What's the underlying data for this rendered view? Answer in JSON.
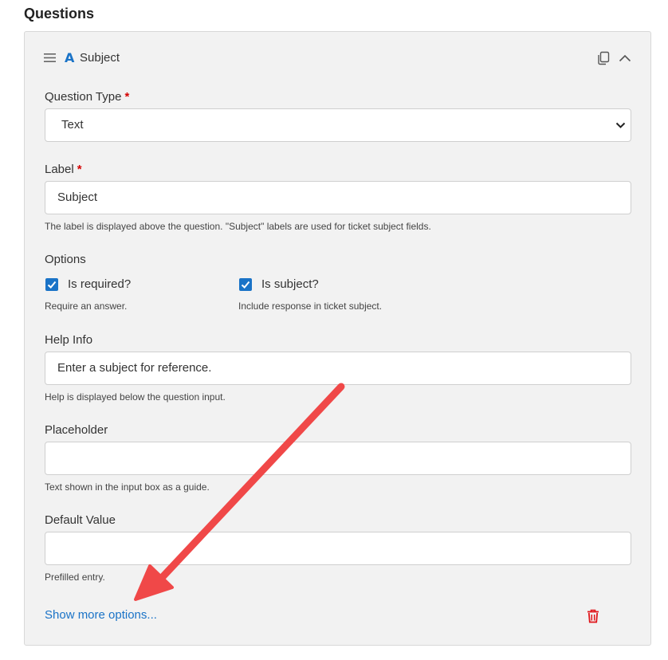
{
  "section": {
    "title": "Questions"
  },
  "question": {
    "title": "Subject",
    "type_icon": "A",
    "icons": {
      "drag": "drag-handle-icon",
      "type": "text-type-icon",
      "copy": "copy-icon",
      "collapse": "chevron-up-icon"
    },
    "question_type": {
      "label": "Question Type",
      "required_mark": "*",
      "value": "Text"
    },
    "label_field": {
      "label": "Label",
      "required_mark": "*",
      "value": "Subject",
      "hint": "The label is displayed above the question. \"Subject\" labels are used for ticket subject fields."
    },
    "options": {
      "label": "Options",
      "items": [
        {
          "label": "Is required?",
          "checked": true,
          "hint": "Require an answer."
        },
        {
          "label": "Is subject?",
          "checked": true,
          "hint": "Include response in ticket subject."
        }
      ]
    },
    "help_info": {
      "label": "Help Info",
      "value": "Enter a subject for reference.",
      "hint": "Help is displayed below the question input."
    },
    "placeholder": {
      "label": "Placeholder",
      "value": "",
      "hint": "Text shown in the input box as a guide."
    },
    "default_value": {
      "label": "Default Value",
      "value": "",
      "hint": "Prefilled entry."
    },
    "more_options_link": "Show more options...",
    "delete_icon": "trash-icon"
  },
  "colors": {
    "accent": "#1a73c7",
    "required": "#d40000",
    "delete": "#e0161b",
    "annotation_arrow": "#f04848"
  }
}
